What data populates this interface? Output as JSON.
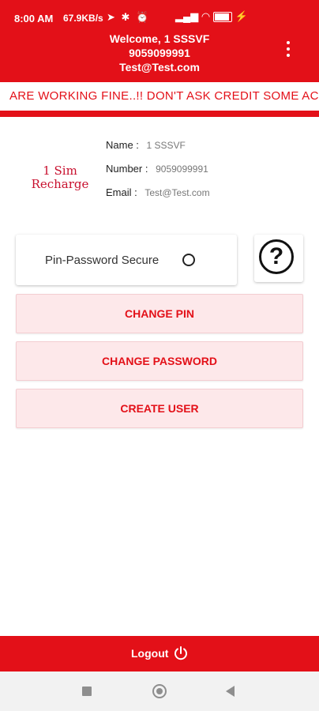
{
  "status_bar": {
    "time": "8:00 AM",
    "network_speed": "67.9KB/s",
    "battery_percent": 100,
    "icons": [
      "navigation-icon",
      "bluetooth-icon",
      "alarm-icon",
      "signal-icon",
      "wifi-icon",
      "battery-icon",
      "charging-icon"
    ]
  },
  "header": {
    "welcome": "Welcome, 1 SSSVF",
    "phone": "9059099991",
    "email": "Test@Test.com",
    "menu_icon": "more-vert-icon"
  },
  "marquee": {
    "text": "ARE WORKING FINE..!! DON'T ASK CREDIT SOME ACCOU"
  },
  "logo": {
    "line1": "1 Sim",
    "line2": "Recharge"
  },
  "profile": {
    "name_label": "Name :",
    "name_value": "1 SSSVF",
    "number_label": "Number :",
    "number_value": "9059099991",
    "email_label": "Email :",
    "email_value": "Test@Test.com"
  },
  "security": {
    "label": "Pin-Password Secure",
    "help_icon": "question-circle-icon"
  },
  "actions": {
    "change_pin": "CHANGE PIN",
    "change_password": "CHANGE PASSWORD",
    "create_user": "CREATE USER"
  },
  "footer": {
    "logout": "Logout",
    "power_icon": "power-icon"
  },
  "colors": {
    "brand_red": "#e31018",
    "button_bg": "#fde8ea"
  }
}
